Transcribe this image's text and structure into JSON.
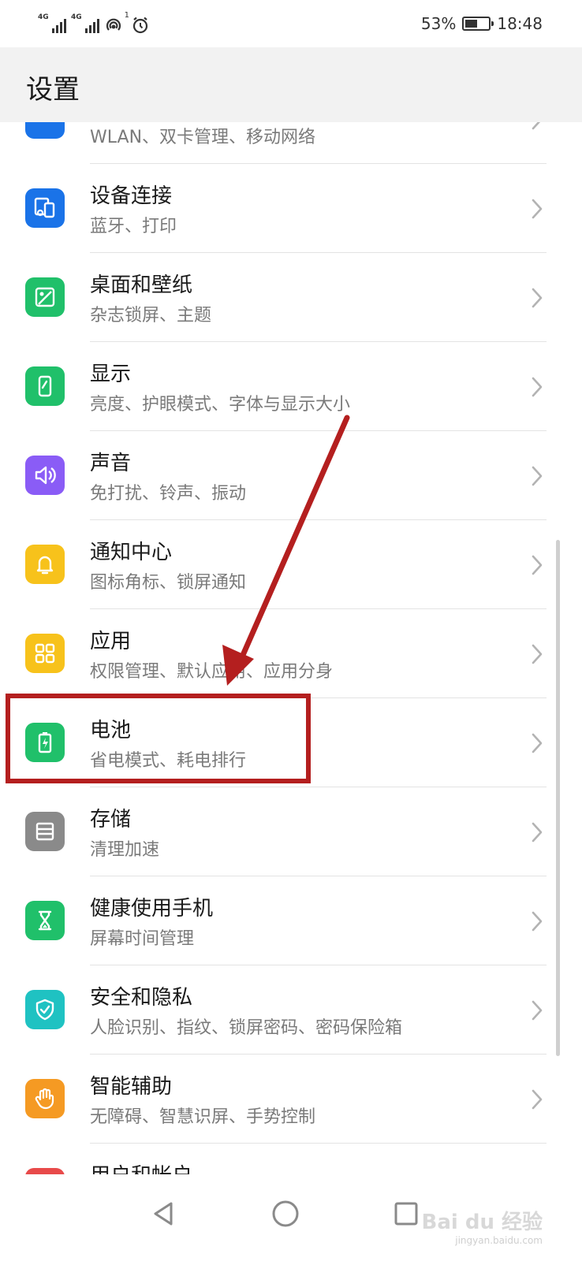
{
  "status_bar": {
    "sim1_tag": "4G",
    "sim2_tag": "4G",
    "hotspot_count": "1",
    "battery_percent": "53%",
    "battery_level": 0.53,
    "time": "18:48"
  },
  "header": {
    "title": "设置"
  },
  "settings": [
    {
      "title": "",
      "subtitle": "WLAN、双卡管理、移动网络",
      "icon": "network-icon",
      "color": "#1a73e8"
    },
    {
      "title": "设备连接",
      "subtitle": "蓝牙、打印",
      "icon": "device-connection-icon",
      "color": "#1a73e8"
    },
    {
      "title": "桌面和壁纸",
      "subtitle": "杂志锁屏、主题",
      "icon": "wallpaper-icon",
      "color": "#20c06a"
    },
    {
      "title": "显示",
      "subtitle": "亮度、护眼模式、字体与显示大小",
      "icon": "display-icon",
      "color": "#20c06a"
    },
    {
      "title": "声音",
      "subtitle": "免打扰、铃声、振动",
      "icon": "sound-icon",
      "color": "#8a5cf6"
    },
    {
      "title": "通知中心",
      "subtitle": "图标角标、锁屏通知",
      "icon": "bell-icon",
      "color": "#f7c21b"
    },
    {
      "title": "应用",
      "subtitle": "权限管理、默认应用、应用分身",
      "icon": "apps-icon",
      "color": "#f7c21b"
    },
    {
      "title": "电池",
      "subtitle": "省电模式、耗电排行",
      "icon": "battery-icon",
      "color": "#20c06a"
    },
    {
      "title": "存储",
      "subtitle": "清理加速",
      "icon": "storage-icon",
      "color": "#8a8a8a"
    },
    {
      "title": "健康使用手机",
      "subtitle": "屏幕时间管理",
      "icon": "hourglass-icon",
      "color": "#20c06a"
    },
    {
      "title": "安全和隐私",
      "subtitle": "人脸识别、指纹、锁屏密码、密码保险箱",
      "icon": "shield-icon",
      "color": "#1fc2c2"
    },
    {
      "title": "智能辅助",
      "subtitle": "无障碍、智慧识屏、手势控制",
      "icon": "hand-icon",
      "color": "#f59a23"
    },
    {
      "title": "用户和帐户",
      "subtitle": "",
      "icon": "user-icon",
      "color": "#e84a4a"
    }
  ],
  "navbar": {
    "back": "back-icon",
    "home": "home-icon",
    "recents": "recents-icon"
  },
  "watermark": {
    "brand": "Bai du 经验",
    "url": "jingyan.baidu.com"
  },
  "annotation": {
    "highlight_color": "#b41f1f"
  }
}
